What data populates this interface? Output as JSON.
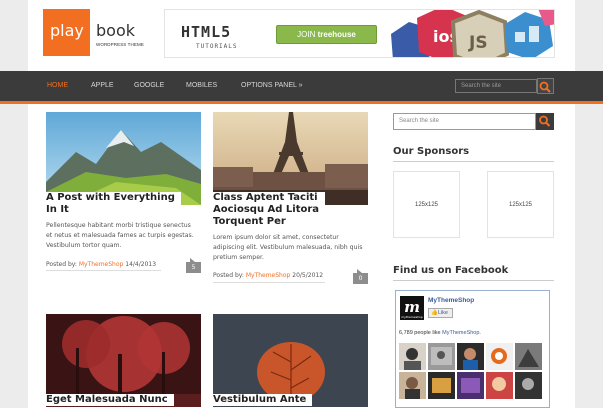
{
  "logo": {
    "play": "play",
    "book": "book",
    "subtitle": "WORDPRESS THEME"
  },
  "banner": {
    "title": "HTML5",
    "subtitle": "TUTORIALS",
    "button_prefix": "JOIN",
    "button_brand": "treehouse",
    "badges": [
      "ios",
      "JS"
    ]
  },
  "nav": {
    "items": [
      "HOME",
      "APPLE",
      "GOOGLE",
      "MOBILES",
      "OPTIONS PANEL »"
    ],
    "search_placeholder": "Search the site"
  },
  "posts": [
    {
      "title_line1": "A Post with Everything",
      "title_line2": "In It",
      "excerpt": [
        "Pellentesque habitant morbi tristique senectus",
        "et netus et malesuada fames ac turpis egestas.",
        "Vestibulum tortor quam."
      ],
      "posted_by": "Posted by:",
      "author": "MyThemeShop",
      "date": "14/4/2013",
      "comments": "5"
    },
    {
      "title_line1": "Class Aptent Taciti",
      "title_line2": "Aociosqu Ad Litora",
      "title_line3": "Torquent Per",
      "excerpt": [
        "Lorem ipsum dolor sit amet, consectetur",
        "adipiscing elit. Vestibulum malesuada, nibh quis",
        "pretium semper."
      ],
      "posted_by": "Posted by:",
      "author": "MyThemeShop",
      "date": "20/5/2012",
      "comments": "0"
    },
    {
      "title_line1": "Eget Malesuada Nunc"
    },
    {
      "title_line1": "Vestibulum Ante"
    }
  ],
  "sidebar": {
    "search_placeholder": "Search the site",
    "sponsors_title": "Our Sponsors",
    "sponsor_labels": [
      "125x125",
      "125x125"
    ],
    "facebook_title": "Find us on Facebook",
    "fb": {
      "logo": "m",
      "logo_sub": "mythemeshop",
      "page_name": "MyThemeShop",
      "like": "Like",
      "count_text": "6,789 people like",
      "count_link": "MyThemeShop."
    }
  },
  "colors": {
    "accent": "#f26f21",
    "nav_bg": "#3b3b3b",
    "fb_blue": "#3b5998"
  }
}
